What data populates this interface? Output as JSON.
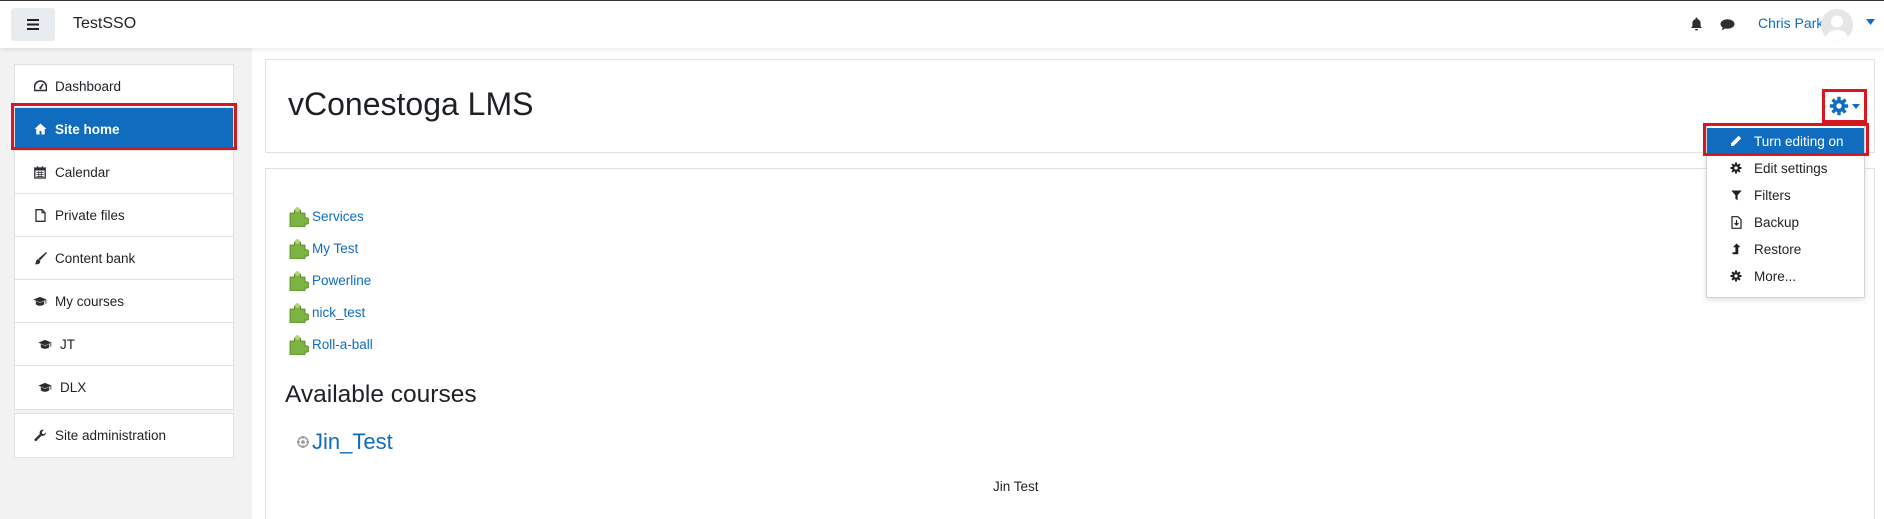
{
  "navbar": {
    "site_name": "TestSSO",
    "user_name": "Chris Park",
    "icons": [
      "menu-icon",
      "bell-icon",
      "chat-icon",
      "avatar",
      "caret-down-icon"
    ]
  },
  "sidebar": {
    "items": [
      {
        "label": "Dashboard",
        "icon": "dashboard-icon"
      },
      {
        "label": "Site home",
        "icon": "home-icon",
        "active": true
      },
      {
        "label": "Calendar",
        "icon": "calendar-icon"
      },
      {
        "label": "Private files",
        "icon": "file-icon"
      },
      {
        "label": "Content bank",
        "icon": "brush-icon"
      },
      {
        "label": "My courses",
        "icon": "graduation-cap-icon"
      },
      {
        "label": "JT",
        "icon": "graduation-cap-icon"
      },
      {
        "label": "DLX",
        "icon": "graduation-cap-icon"
      }
    ],
    "admin": {
      "label": "Site administration",
      "icon": "wrench-icon"
    }
  },
  "header": {
    "title": "vConestoga LMS"
  },
  "settings_menu": {
    "items": [
      {
        "label": "Turn editing on",
        "icon": "pencil-icon",
        "active": true
      },
      {
        "label": "Edit settings",
        "icon": "gear-icon"
      },
      {
        "label": "Filters",
        "icon": "filter-icon"
      },
      {
        "label": "Backup",
        "icon": "backup-icon"
      },
      {
        "label": "Restore",
        "icon": "restore-icon"
      },
      {
        "label": "More...",
        "icon": "gear-icon"
      }
    ]
  },
  "main": {
    "activities": [
      "Services",
      "My Test",
      "Powerline",
      "nick_test",
      "Roll-a-ball"
    ],
    "courses_heading": "Available courses",
    "course": {
      "name": "Jin_Test",
      "teacher": "Jin Test"
    }
  },
  "colors": {
    "accent": "#0f6cbf",
    "highlight_border": "#d8171e",
    "sidebar_bg": "#f2f2f2",
    "puzzle_green": "#7cb342"
  }
}
